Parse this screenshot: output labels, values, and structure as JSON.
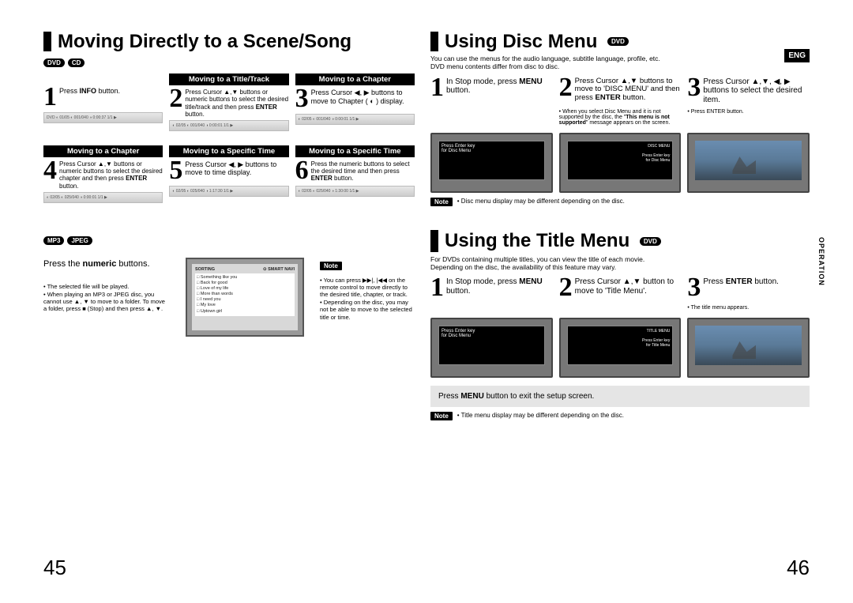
{
  "left": {
    "title": "Moving Directly to a Scene/Song",
    "tags": [
      "DVD",
      "CD"
    ],
    "row1": [
      {
        "num": "1",
        "header": "",
        "text_html": "Press <b>INFO</b> button."
      },
      {
        "num": "2",
        "header": "Moving to a Title/Track",
        "text_html": "Press Cursor ▲,▼ buttons or numeric buttons to select the desired title/track and then press <b>ENTER</b> button."
      },
      {
        "num": "3",
        "header": "Moving to a Chapter",
        "text_html": "Press Cursor ◀, ▶ buttons to move to Chapter ( ◐ ) display."
      }
    ],
    "row2": [
      {
        "num": "4",
        "header": "Moving to a Chapter",
        "text_html": "Press Cursor ▲,▼ buttons or numeric buttons to select the desired chapter and then press <b>ENTER</b> button."
      },
      {
        "num": "5",
        "header": "Moving to a Specific Time",
        "text_html": "Press Cursor ◀, ▶ buttons to move to time display."
      },
      {
        "num": "6",
        "header": "Moving to a Specific Time",
        "text_html": "Press the numeric buttons to select the desired time and then press <b>ENTER</b> button."
      }
    ],
    "mp3_tags": [
      "MP3",
      "JPEG"
    ],
    "numeric_text": "Press the <b>numeric</b> buttons.",
    "numeric_bullets": "• The selected file will be played.<br>• When playing an MP3 or JPEG disc, you cannot use ▲, ▼ to move to a folder. To move a folder, press ■ (Stop) and then press ▲, ▼.",
    "note_label": "Note",
    "note_bullets": "• You can press ▶▶|, |◀◀ on the remote control to move directly to the desired title, chapter, or track.<br>• Depending on the disc, you may not be able to move to the selected title or time.",
    "pagenum": "45"
  },
  "right": {
    "eng": "ENG",
    "disc_title": "Using Disc Menu",
    "disc_tag": "DVD",
    "disc_sub": "You can use the menus for the audio language, subtitle language, profile, etc.<br>DVD menu contents differ from disc to disc.",
    "disc_steps": [
      {
        "num": "1",
        "text_html": "In Stop mode, press <b>MENU</b> button."
      },
      {
        "num": "2",
        "text_html": "Press Cursor ▲,▼ buttons to move to 'DISC MENU' and then press <b>ENTER</b> button."
      },
      {
        "num": "3",
        "text_html": "Press Cursor ▲,▼, ◀, ▶ buttons to select the desired item."
      }
    ],
    "disc_bullets": [
      "• When you select Disc Menu and it is not supported by the disc, the \"<b>This menu is not supported</b>\" message appears on the screen.",
      "• Press ENTER button."
    ],
    "disc_note_label": "Note",
    "disc_note_text": "• Disc menu display may be different depending on the disc.",
    "operation": "OPERATION",
    "title_title": "Using the Title Menu",
    "title_tag": "DVD",
    "title_sub": "For DVDs containing multiple titles, you can view the title of each movie.<br>Depending on the disc, the availability of this feature may vary.",
    "title_steps": [
      {
        "num": "1",
        "text_html": "In Stop mode, press <b>MENU</b> button."
      },
      {
        "num": "2",
        "text_html": "Press Cursor ▲,▼ button to move to 'Title Menu'."
      },
      {
        "num": "3",
        "text_html": "Press <b>ENTER</b> button."
      }
    ],
    "title_bullets": [
      "• The title menu appears."
    ],
    "exit_text": "Press <b>MENU</b> button to exit the setup screen.",
    "title_note_label": "Note",
    "title_note_text": "• Title menu display may be different depending on the disc.",
    "pagenum": "46"
  }
}
